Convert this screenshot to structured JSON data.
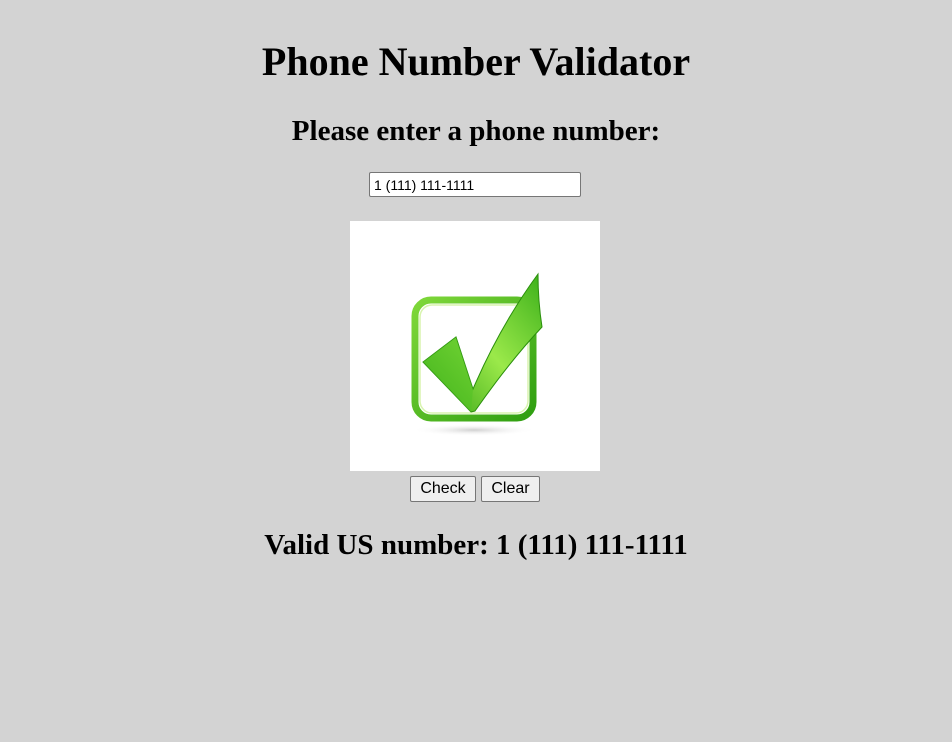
{
  "page": {
    "title": "Phone Number Validator",
    "prompt": "Please enter a phone number:"
  },
  "input": {
    "value": "1 (111) 111-1111"
  },
  "status_image": {
    "icon": "checkmark-icon",
    "state": "valid",
    "colors": {
      "green_light": "#9be94a",
      "green_dark": "#2e9e10"
    }
  },
  "buttons": {
    "check_label": "Check",
    "clear_label": "Clear"
  },
  "result": {
    "text": "Valid US number: 1 (111) 111-1111"
  },
  "colors": {
    "background": "#d3d3d3"
  }
}
